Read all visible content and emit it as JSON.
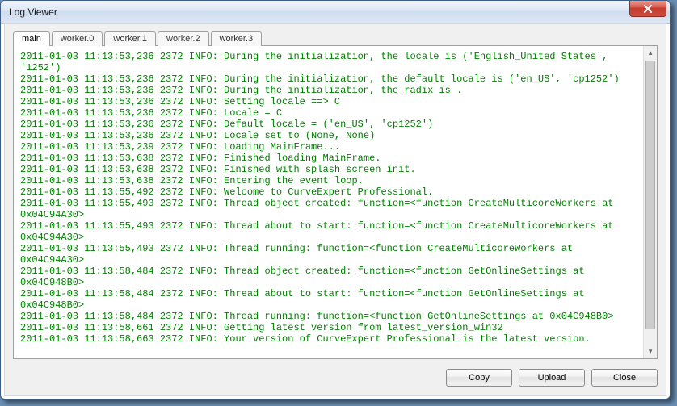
{
  "window": {
    "title": "Log Viewer"
  },
  "tabs": [
    {
      "label": "main",
      "active": true
    },
    {
      "label": "worker.0",
      "active": false
    },
    {
      "label": "worker.1",
      "active": false
    },
    {
      "label": "worker.2",
      "active": false
    },
    {
      "label": "worker.3",
      "active": false
    }
  ],
  "log_lines": [
    "2011-01-03 11:13:53,236 2372 INFO: During the initialization, the locale is ('English_United States', '1252')",
    "2011-01-03 11:13:53,236 2372 INFO: During the initialization, the default locale is ('en_US', 'cp1252')",
    "2011-01-03 11:13:53,236 2372 INFO: During the initialization, the radix is .",
    "2011-01-03 11:13:53,236 2372 INFO: Setting locale ==> C",
    "2011-01-03 11:13:53,236 2372 INFO: Locale = C",
    "2011-01-03 11:13:53,236 2372 INFO: Default locale = ('en_US', 'cp1252')",
    "2011-01-03 11:13:53,236 2372 INFO: Locale set to (None, None)",
    "2011-01-03 11:13:53,239 2372 INFO: Loading MainFrame...",
    "2011-01-03 11:13:53,638 2372 INFO: Finished loading MainFrame.",
    "2011-01-03 11:13:53,638 2372 INFO: Finished with splash screen init.",
    "2011-01-03 11:13:53,638 2372 INFO: Entering the event loop.",
    "2011-01-03 11:13:55,492 2372 INFO: Welcome to CurveExpert Professional.",
    "2011-01-03 11:13:55,493 2372 INFO: Thread object created: function=<function CreateMulticoreWorkers at 0x04C94A30>",
    "2011-01-03 11:13:55,493 2372 INFO: Thread about to start: function=<function CreateMulticoreWorkers at 0x04C94A30>",
    "2011-01-03 11:13:55,493 2372 INFO: Thread running: function=<function CreateMulticoreWorkers at 0x04C94A30>",
    "2011-01-03 11:13:58,484 2372 INFO: Thread object created: function=<function GetOnlineSettings at 0x04C948B0>",
    "2011-01-03 11:13:58,484 2372 INFO: Thread about to start: function=<function GetOnlineSettings at 0x04C948B0>",
    "2011-01-03 11:13:58,484 2372 INFO: Thread running: function=<function GetOnlineSettings at 0x04C948B0>",
    "2011-01-03 11:13:58,661 2372 INFO: Getting latest version from latest_version_win32",
    "2011-01-03 11:13:58,663 2372 INFO: Your version of CurveExpert Professional is the latest version."
  ],
  "buttons": {
    "copy": "Copy",
    "upload": "Upload",
    "close": "Close"
  }
}
